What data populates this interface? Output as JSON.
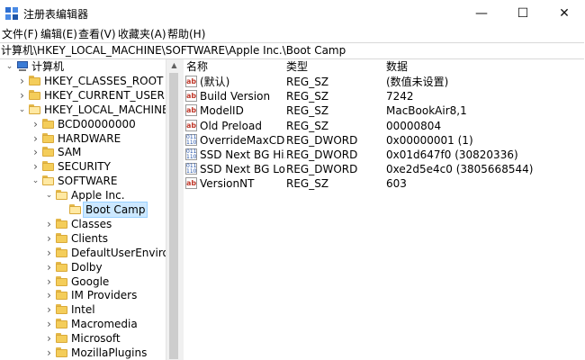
{
  "window": {
    "title": "注册表编辑器"
  },
  "window_controls": {
    "minimize": "—",
    "maximize": "☐",
    "close": "✕"
  },
  "menu": [
    "文件(F)",
    "编辑(E)",
    "查看(V)",
    "收藏夹(A)",
    "帮助(H)"
  ],
  "address": "计算机\\HKEY_LOCAL_MACHINE\\SOFTWARE\\Apple Inc.\\Boot Camp",
  "tree": [
    {
      "label": "计算机",
      "expanded": true,
      "icon": "computer-icon"
    },
    {
      "label": "HKEY_CLASSES_ROOT",
      "expanded": false,
      "icon": "folder-icon"
    },
    {
      "label": "HKEY_CURRENT_USER",
      "expanded": false,
      "icon": "folder-icon"
    },
    {
      "label": "HKEY_LOCAL_MACHINE",
      "expanded": true,
      "icon": "folder-icon"
    },
    {
      "label": "BCD00000000",
      "expanded": false,
      "icon": "folder-icon"
    },
    {
      "label": "HARDWARE",
      "expanded": false,
      "icon": "folder-icon"
    },
    {
      "label": "SAM",
      "expanded": false,
      "icon": "folder-icon"
    },
    {
      "label": "SECURITY",
      "expanded": false,
      "icon": "folder-icon"
    },
    {
      "label": "SOFTWARE",
      "expanded": true,
      "icon": "folder-icon"
    },
    {
      "label": "Apple Inc.",
      "expanded": true,
      "icon": "folder-icon"
    },
    {
      "label": "Boot Camp",
      "expanded": false,
      "icon": "folder-icon",
      "selected": true
    },
    {
      "label": "Classes",
      "expanded": false,
      "icon": "folder-icon"
    },
    {
      "label": "Clients",
      "expanded": false,
      "icon": "folder-icon"
    },
    {
      "label": "DefaultUserEnvironm",
      "expanded": false,
      "icon": "folder-icon"
    },
    {
      "label": "Dolby",
      "expanded": false,
      "icon": "folder-icon"
    },
    {
      "label": "Google",
      "expanded": false,
      "icon": "folder-icon"
    },
    {
      "label": "IM Providers",
      "expanded": false,
      "icon": "folder-icon"
    },
    {
      "label": "Intel",
      "expanded": false,
      "icon": "folder-icon"
    },
    {
      "label": "Macromedia",
      "expanded": false,
      "icon": "folder-icon"
    },
    {
      "label": "Microsoft",
      "expanded": false,
      "icon": "folder-icon"
    },
    {
      "label": "MozillaPlugins",
      "expanded": false,
      "icon": "folder-icon"
    }
  ],
  "columns": {
    "name": "名称",
    "type": "类型",
    "data": "数据"
  },
  "values": [
    {
      "name": "(默认)",
      "type": "REG_SZ",
      "data": "(数值未设置)",
      "icon": "string-value-icon"
    },
    {
      "name": "Build Version",
      "type": "REG_SZ",
      "data": "7242",
      "icon": "string-value-icon"
    },
    {
      "name": "ModelID",
      "type": "REG_SZ",
      "data": "MacBookAir8,1",
      "icon": "string-value-icon"
    },
    {
      "name": "Old Preload",
      "type": "REG_SZ",
      "data": "00000804",
      "icon": "string-value-icon"
    },
    {
      "name": "OverrideMaxCD...",
      "type": "REG_DWORD",
      "data": "0x00000001 (1)",
      "icon": "dword-value-icon"
    },
    {
      "name": "SSD Next BG Hi...",
      "type": "REG_DWORD",
      "data": "0x01d647f0 (30820336)",
      "icon": "dword-value-icon"
    },
    {
      "name": "SSD Next BG Lo...",
      "type": "REG_DWORD",
      "data": "0xe2d5e4c0 (3805668544)",
      "icon": "dword-value-icon"
    },
    {
      "name": "VersionNT",
      "type": "REG_SZ",
      "data": "603",
      "icon": "string-value-icon"
    }
  ],
  "colors": {
    "selection": "#cce8ff",
    "selection_border": "#99d1ff",
    "folder": "#f4cd5a"
  }
}
